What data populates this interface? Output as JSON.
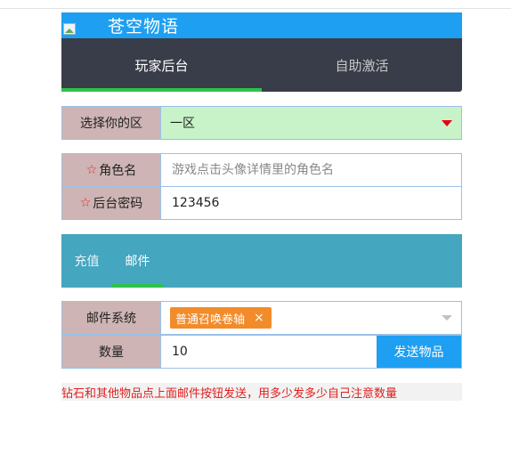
{
  "header": {
    "site_title": "苍空物语"
  },
  "tabs": [
    {
      "label": "玩家后台",
      "active": true
    },
    {
      "label": "自助激活",
      "active": false
    }
  ],
  "zone_select": {
    "label": "选择你的区",
    "value": "一区"
  },
  "role_field": {
    "label": "角色名",
    "placeholder": "游戏点击头像详情里的角色名",
    "value": ""
  },
  "password_field": {
    "label": "后台密码",
    "value": "123456"
  },
  "sub_tabs": [
    {
      "label": "充值",
      "active": false
    },
    {
      "label": "邮件",
      "active": true
    }
  ],
  "mail_system": {
    "label": "邮件系统",
    "selected_item": "普通召唤卷轴",
    "remove_glyph": "×"
  },
  "quantity": {
    "label": "数量",
    "value": "10",
    "send_button": "发送物品"
  },
  "notice": "钻石和其他物品点上面邮件按钮发送，用多少发多少自己注意数量",
  "colors": {
    "header_blue": "#1e9ff2",
    "tab_bar": "#393d49",
    "tab_active_underline": "#2fc24c",
    "sub_tab_bar": "#44a6bf",
    "label_bg": "#ceb4b4",
    "zone_bg": "#c8f3c9",
    "chip_orange": "#f28b2a",
    "notice_red": "#e02020"
  },
  "icons": {
    "required": "star-outline-icon",
    "zone_dropdown": "caret-down-icon",
    "mail_dropdown": "caret-down-icon",
    "logo": "broken-image-icon"
  }
}
